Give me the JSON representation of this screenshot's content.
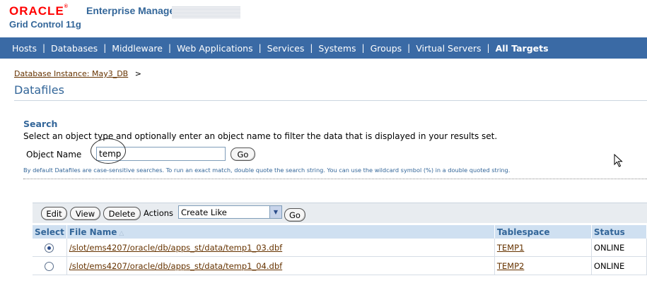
{
  "header": {
    "logo_oracle": "ORACLE",
    "logo_trademark": "®",
    "logo_product": "Enterprise Manager",
    "logo_subtitle": "Grid Control 11g"
  },
  "nav": {
    "items": [
      {
        "label": "Hosts"
      },
      {
        "label": "Databases"
      },
      {
        "label": "Middleware"
      },
      {
        "label": "Web Applications"
      },
      {
        "label": "Services"
      },
      {
        "label": "Systems"
      },
      {
        "label": "Groups"
      },
      {
        "label": "Virtual Servers"
      },
      {
        "label": "All Targets",
        "active": true
      }
    ],
    "separator": "|"
  },
  "breadcrumb": {
    "link": "Database Instance: May3_DB",
    "separator": ">"
  },
  "page_title": "Datafiles",
  "search": {
    "heading": "Search",
    "description": "Select an object type and optionally enter an object name to filter the data that is displayed in your results set.",
    "object_name_label": "Object Name",
    "object_name_value": "temp",
    "go_label": "Go",
    "note": "By default Datafiles are case-sensitive searches. To run an exact match, double quote the search string. You can use the wildcard symbol (%) in a double quoted string."
  },
  "actions": {
    "edit_label": "Edit",
    "view_label": "View",
    "delete_label": "Delete",
    "actions_label": "Actions",
    "selected_action": "Create Like",
    "go_label": "Go"
  },
  "table": {
    "columns": {
      "select": "Select",
      "file_name": "File Name",
      "tablespace": "Tablespace",
      "status": "Status"
    },
    "rows": [
      {
        "selected": true,
        "file_name": "/slot/ems4207/oracle/db/apps_st/data/temp1_03.dbf",
        "tablespace": "TEMP1",
        "status": "ONLINE"
      },
      {
        "selected": false,
        "file_name": "/slot/ems4207/oracle/db/apps_st/data/temp1_04.dbf",
        "tablespace": "TEMP2",
        "status": "ONLINE"
      }
    ]
  },
  "colors": {
    "navbar": "#3a6aa5",
    "heading_blue": "#336699",
    "link_brown": "#663300",
    "oracle_red": "#ff0000"
  }
}
